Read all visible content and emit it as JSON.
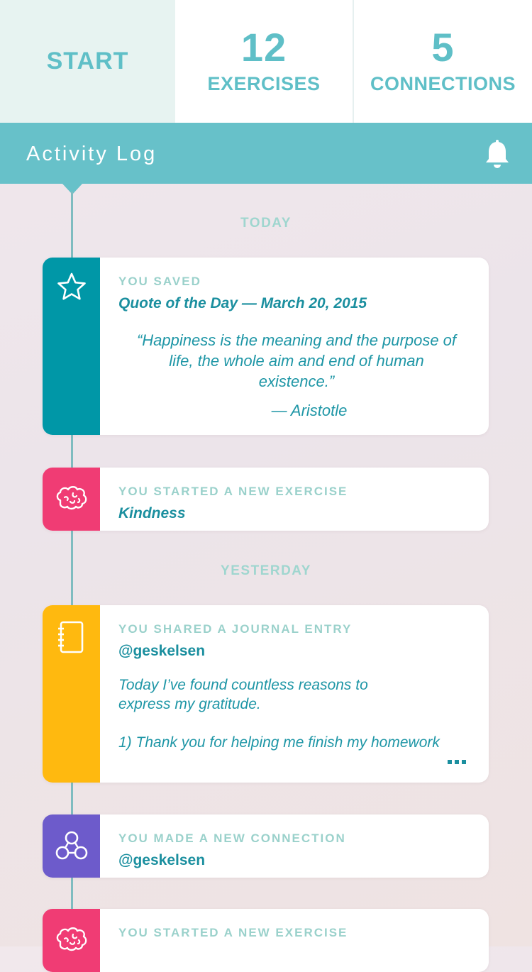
{
  "stats": {
    "start_label": "START",
    "exercises_count": "12",
    "exercises_label": "EXERCISES",
    "connections_count": "5",
    "connections_label": "CONNECTIONS"
  },
  "header": {
    "title": "Activity Log",
    "icon": "bell-icon"
  },
  "colors": {
    "teal": "#67c1c9",
    "saved": "#0097a7",
    "exercise": "#f03c74",
    "journal": "#ffb90f",
    "connection": "#6d5bcb"
  },
  "timeline": {
    "today_label": "TODAY",
    "yesterday_label": "YESTERDAY",
    "items": [
      {
        "kicker": "YOU SAVED",
        "subject": "Quote of the Day — March 20, 2015",
        "quote": "“Happiness is the meaning and the purpose of life, the whole aim and end of human existence.”",
        "author": "— Aristotle",
        "icon": "star-icon"
      },
      {
        "kicker": "YOU STARTED A NEW EXERCISE",
        "subject": "Kindness",
        "icon": "brain-icon"
      },
      {
        "kicker": "YOU SHARED A JOURNAL ENTRY",
        "subject": "@geskelsen",
        "text": "Today I’ve found countless reasons to\nexpress my gratitude.\n\n1) Thank you for helping me finish my homework",
        "icon": "journal-icon"
      },
      {
        "kicker": "YOU MADE A NEW CONNECTION",
        "subject": "@geskelsen",
        "icon": "connection-icon"
      },
      {
        "kicker": "YOU STARTED A NEW EXERCISE",
        "icon": "brain-icon"
      }
    ]
  }
}
